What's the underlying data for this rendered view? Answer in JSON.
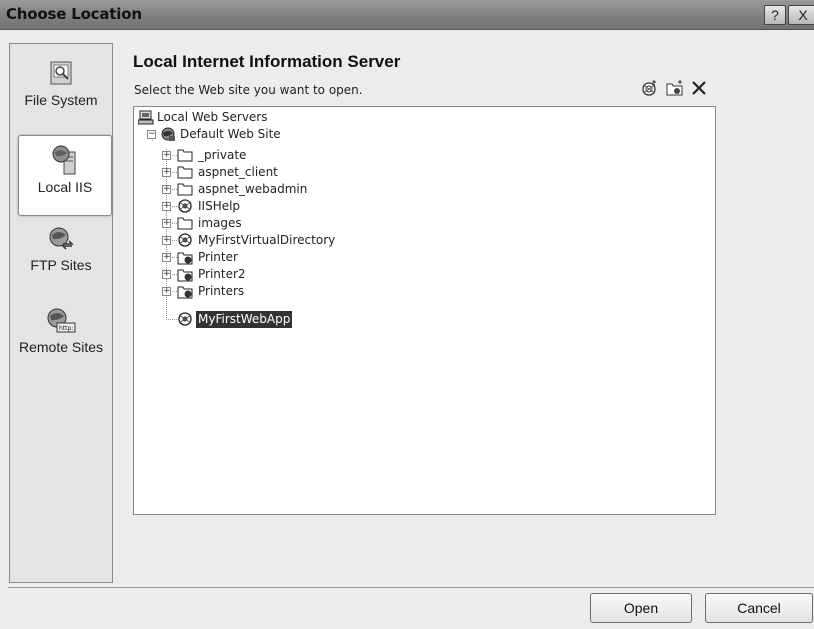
{
  "window": {
    "title": "Choose Location",
    "help_label": "?",
    "close_label": "X"
  },
  "sidebar": {
    "items": [
      {
        "label": "File System",
        "icon": "file-system-icon",
        "active": false
      },
      {
        "label": "Local IIS",
        "icon": "local-iis-icon",
        "active": true
      },
      {
        "label": "FTP Sites",
        "icon": "ftp-sites-icon",
        "active": false
      },
      {
        "label": "Remote Sites",
        "icon": "remote-sites-icon",
        "active": false
      }
    ]
  },
  "main": {
    "heading": "Local Internet Information Server",
    "subtitle": "Select the Web site you want to open.",
    "toolbar_icons": [
      "create-web-application-icon",
      "create-virtual-directory-icon",
      "delete-icon"
    ],
    "tree": {
      "root": "Local Web Servers",
      "site": "Default Web Site",
      "children": [
        {
          "label": "_private",
          "icon": "folder-icon",
          "expandable": true
        },
        {
          "label": "aspnet_client",
          "icon": "folder-icon",
          "expandable": true
        },
        {
          "label": "aspnet_webadmin",
          "icon": "folder-icon",
          "expandable": true
        },
        {
          "label": "IISHelp",
          "icon": "web-application-icon",
          "expandable": true
        },
        {
          "label": "images",
          "icon": "folder-icon",
          "expandable": true
        },
        {
          "label": "MyFirstVirtualDirectory",
          "icon": "web-application-icon",
          "expandable": true
        },
        {
          "label": "Printer",
          "icon": "virtual-directory-icon",
          "expandable": true
        },
        {
          "label": "Printer2",
          "icon": "virtual-directory-icon",
          "expandable": true
        },
        {
          "label": "Printers",
          "icon": "virtual-directory-icon",
          "expandable": true
        },
        {
          "label": "MyFirstWebApp",
          "icon": "web-application-icon",
          "expandable": false,
          "selected": true
        }
      ]
    }
  },
  "buttons": {
    "open": "Open",
    "cancel": "Cancel"
  }
}
